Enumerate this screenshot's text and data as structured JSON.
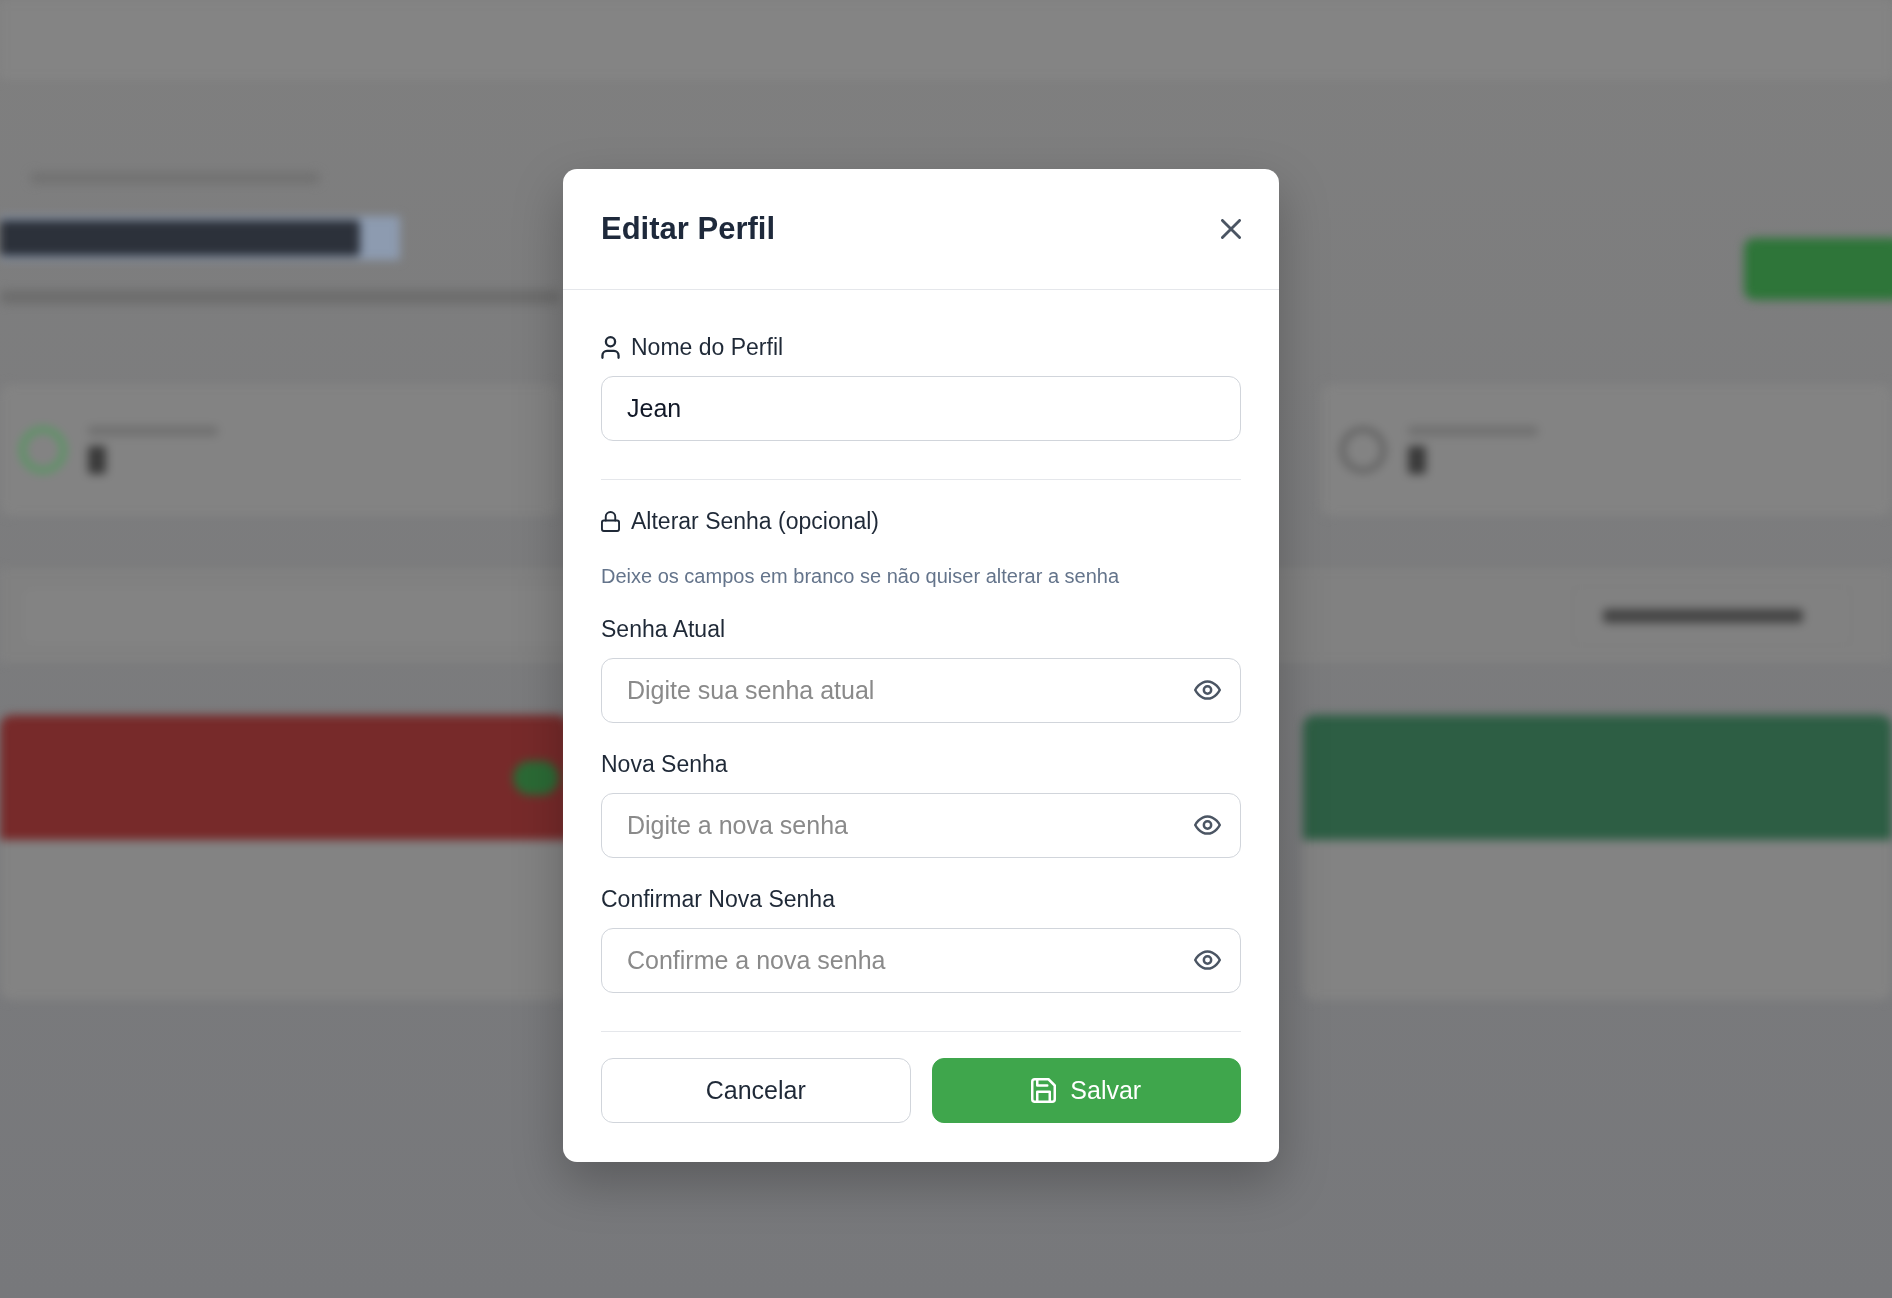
{
  "dialog": {
    "title": "Editar Perfil"
  },
  "profile_name": {
    "label": "Nome do Perfil",
    "value": "Jean"
  },
  "password_section": {
    "title": "Alterar Senha (opcional)",
    "hint": "Deixe os campos em branco se não quiser alterar a senha",
    "fields": [
      {
        "label": "Senha Atual",
        "placeholder": "Digite sua senha atual"
      },
      {
        "label": "Nova Senha",
        "placeholder": "Digite a nova senha"
      },
      {
        "label": "Confirmar Nova Senha",
        "placeholder": "Confirme a nova senha"
      }
    ]
  },
  "buttons": [
    {
      "label": "Cancelar",
      "kind": "secondary"
    },
    {
      "label": "Salvar",
      "kind": "primary"
    }
  ]
}
